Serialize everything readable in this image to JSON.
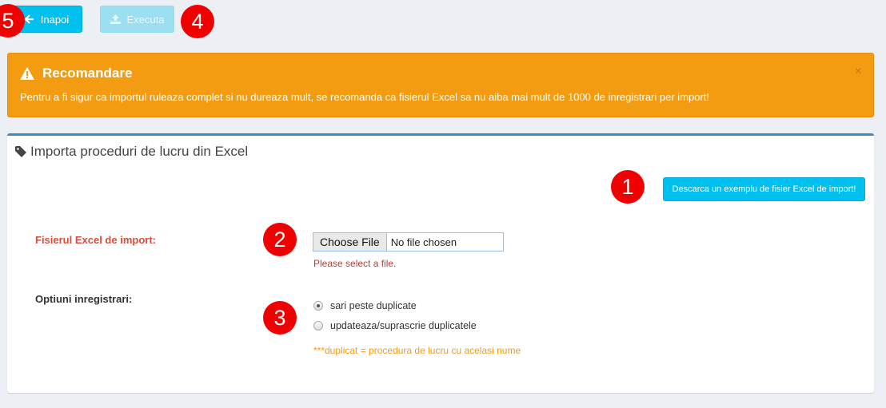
{
  "toolbar": {
    "back_label": "Inapoi",
    "back_icon": "arrow-left-icon",
    "execute_label": "Executa",
    "execute_icon": "upload-icon"
  },
  "badges": {
    "b1": "1",
    "b2": "2",
    "b3": "3",
    "b4": "4",
    "b5": "5"
  },
  "alert": {
    "icon": "warning-icon",
    "title": "Recomandare",
    "text": "Pentru a fi sigur ca importul ruleaza complet si nu dureaza mult, se recomanda ca fisierul Excel sa nu aiba mai mult de 1000 de inregistrari per import!",
    "close": "×",
    "color": "#f39c12"
  },
  "box": {
    "icon": "tag-icon",
    "title": "Importa proceduri de lucru din Excel",
    "sample_button": "Descarca un exemplu de fisier Excel de import!",
    "file_label": "Fisierul Excel de import:",
    "file_button": "Choose File",
    "file_status": "No file chosen",
    "file_error": "Please select a file.",
    "options_label": "Optiuni inregistrari:",
    "options": [
      {
        "label": "sari peste duplicate",
        "checked": true
      },
      {
        "label": "updateaza/suprascrie duplicatele",
        "checked": false
      }
    ],
    "note": "***duplicat = procedura de lucru cu acelasi nume"
  },
  "colors": {
    "accent": "#00c0ef",
    "box_border": "#3c8dbc",
    "error": "#dd4b39",
    "badge": "#f00000"
  }
}
